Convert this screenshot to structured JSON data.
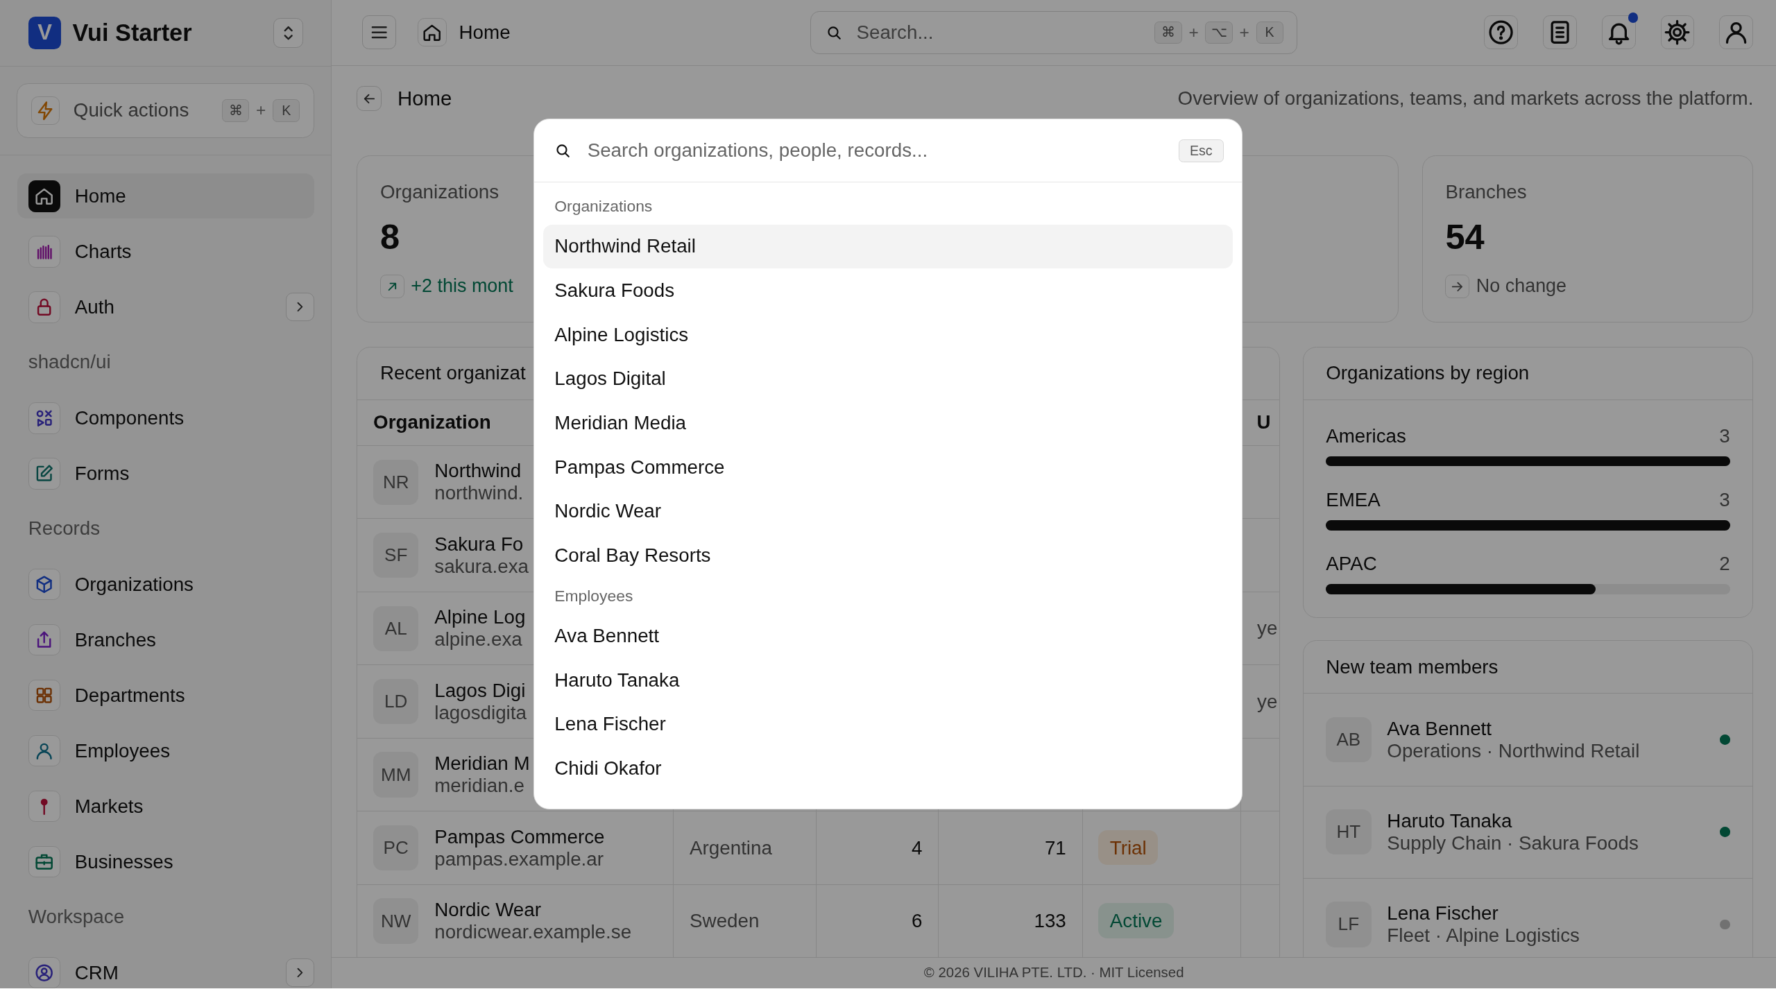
{
  "sidebar": {
    "logo": "V",
    "brand": "Vui Starter",
    "quick_actions": {
      "label": "Quick actions",
      "shortcut": [
        {
          "kind": "key",
          "text": "⌘"
        },
        {
          "kind": "plus",
          "text": "+"
        },
        {
          "kind": "key",
          "text": "K"
        }
      ]
    },
    "sections": [
      {
        "items": [
          {
            "label": "Home",
            "selected": true,
            "expandable": false
          },
          {
            "label": "Charts",
            "selected": false,
            "expandable": false
          },
          {
            "label": "Auth",
            "selected": false,
            "expandable": true
          }
        ]
      },
      {
        "title": "shadcn/ui",
        "items": [
          {
            "label": "Components",
            "selected": false,
            "expandable": false
          },
          {
            "label": "Forms",
            "selected": false,
            "expandable": false
          }
        ]
      },
      {
        "title": "Records",
        "items": [
          {
            "label": "Organizations",
            "selected": false,
            "expandable": false
          },
          {
            "label": "Branches",
            "selected": false,
            "expandable": false
          },
          {
            "label": "Departments",
            "selected": false,
            "expandable": false
          },
          {
            "label": "Employees",
            "selected": false,
            "expandable": false
          },
          {
            "label": "Markets",
            "selected": false,
            "expandable": false
          },
          {
            "label": "Businesses",
            "selected": false,
            "expandable": false
          }
        ]
      },
      {
        "title": "Workspace",
        "items": [
          {
            "label": "CRM",
            "selected": false,
            "expandable": true
          }
        ]
      }
    ]
  },
  "topbar": {
    "page": "Home",
    "search": {
      "placeholder": "Search...",
      "shortcut": [
        {
          "kind": "key",
          "text": "⌘"
        },
        {
          "kind": "plus",
          "text": "+"
        },
        {
          "kind": "key",
          "text": "⌥"
        },
        {
          "kind": "plus",
          "text": "+"
        },
        {
          "kind": "key",
          "text": "K"
        }
      ]
    },
    "notifications_unread": true
  },
  "header": {
    "title": "Home",
    "description": "Overview of organizations, teams, and markets across the platform."
  },
  "stats": [
    {
      "label": "Organizations",
      "value": "8",
      "kind": "up",
      "note": "+2 this mont"
    },
    {
      "label": "Branches",
      "value": "54",
      "kind": "flat",
      "note": "No change"
    }
  ],
  "table": {
    "title": "Recent organizat",
    "header": {
      "column_1": "Organization",
      "column_6": "U"
    },
    "rows": [
      {
        "initials": "NR",
        "name": "Northwind",
        "domain": "northwind."
      },
      {
        "initials": "SF",
        "name": "Sakura Fo",
        "domain": "sakura.exa"
      },
      {
        "initials": "AL",
        "name": "Alpine Log",
        "domain": "alpine.exa",
        "column_6": "ye"
      },
      {
        "initials": "LD",
        "name": "Lagos Digi",
        "domain": "lagosdigita",
        "column_6": "ye"
      },
      {
        "initials": "MM",
        "name": "Meridian M",
        "domain": "meridian.e"
      },
      {
        "initials": "PC",
        "name": "Pampas Commerce",
        "domain": "pampas.example.ar",
        "country": "Argentina",
        "column_3": "4",
        "column_4": "71",
        "status": {
          "text": "Trial",
          "kind": "trial"
        }
      },
      {
        "initials": "NW",
        "name": "Nordic Wear",
        "domain": "nordicwear.example.se",
        "country": "Sweden",
        "column_3": "6",
        "column_4": "133",
        "status": {
          "text": "Active",
          "kind": "active"
        }
      }
    ]
  },
  "regions": {
    "title": "Organizations by region",
    "items": [
      {
        "name": "Americas",
        "count": "3",
        "level": 1
      },
      {
        "name": "EMEA",
        "count": "3",
        "level": 1
      },
      {
        "name": "APAC",
        "count": "2",
        "level": 0.667
      }
    ]
  },
  "members": {
    "title": "New team members",
    "items": [
      {
        "initials": "AB",
        "name": "Ava Bennett",
        "detail": "Operations · Northwind Retail",
        "online": true
      },
      {
        "initials": "HT",
        "name": "Haruto Tanaka",
        "detail": "Supply Chain · Sakura Foods",
        "online": true
      },
      {
        "initials": "LF",
        "name": "Lena Fischer",
        "detail": "Fleet · Alpine Logistics",
        "online": false
      }
    ]
  },
  "footer": "© 2026 VILIHA PTE. LTD. · MIT Licensed",
  "command_palette": {
    "placeholder": "Search organizations, people, records...",
    "close_key": "Esc",
    "groups": [
      {
        "title": "Organizations",
        "items": [
          {
            "label": "Northwind Retail",
            "selected": true
          },
          {
            "label": "Sakura Foods",
            "selected": false
          },
          {
            "label": "Alpine Logistics",
            "selected": false
          },
          {
            "label": "Lagos Digital",
            "selected": false
          },
          {
            "label": "Meridian Media",
            "selected": false
          },
          {
            "label": "Pampas Commerce",
            "selected": false
          },
          {
            "label": "Nordic Wear",
            "selected": false
          },
          {
            "label": "Coral Bay Resorts",
            "selected": false
          }
        ]
      },
      {
        "title": "Employees",
        "items": [
          {
            "label": "Ava Bennett",
            "selected": false
          },
          {
            "label": "Haruto Tanaka",
            "selected": false
          },
          {
            "label": "Lena Fischer",
            "selected": false
          },
          {
            "label": "Chidi Okafor",
            "selected": false
          }
        ]
      }
    ]
  }
}
